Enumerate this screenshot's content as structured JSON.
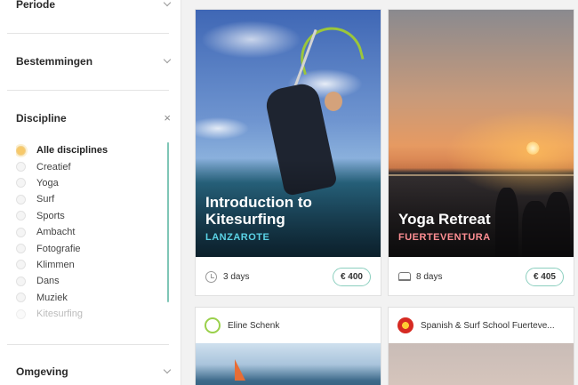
{
  "sidebar": {
    "sections": {
      "periode": "Periode",
      "bestemmingen": "Bestemmingen",
      "discipline": "Discipline",
      "omgeving": "Omgeving"
    },
    "disciplines": [
      "Alle disciplines",
      "Creatief",
      "Yoga",
      "Surf",
      "Sports",
      "Ambacht",
      "Fotografie",
      "Klimmen",
      "Dans",
      "Muziek",
      "Kitesurfing"
    ],
    "selected_index": 0
  },
  "cards": [
    {
      "title_line1": "Introduction to",
      "title_line2": "Kitesurfing",
      "location": "LANZAROTE",
      "location_color": "#5bd3e6",
      "duration": "3 days",
      "price": "€ 400"
    },
    {
      "title_line1": "Yoga Retreat",
      "location": "FUERTEVENTURA",
      "location_color": "#ff8f93",
      "duration": "8 days",
      "price": "€ 405"
    }
  ],
  "bottom_cards": [
    {
      "host": "Eline Schenk"
    },
    {
      "host": "Spanish & Surf School Fuerteve..."
    }
  ],
  "colors": {
    "accent_teal": "#8ccfbf",
    "selected_radio": "#f7c96a"
  }
}
